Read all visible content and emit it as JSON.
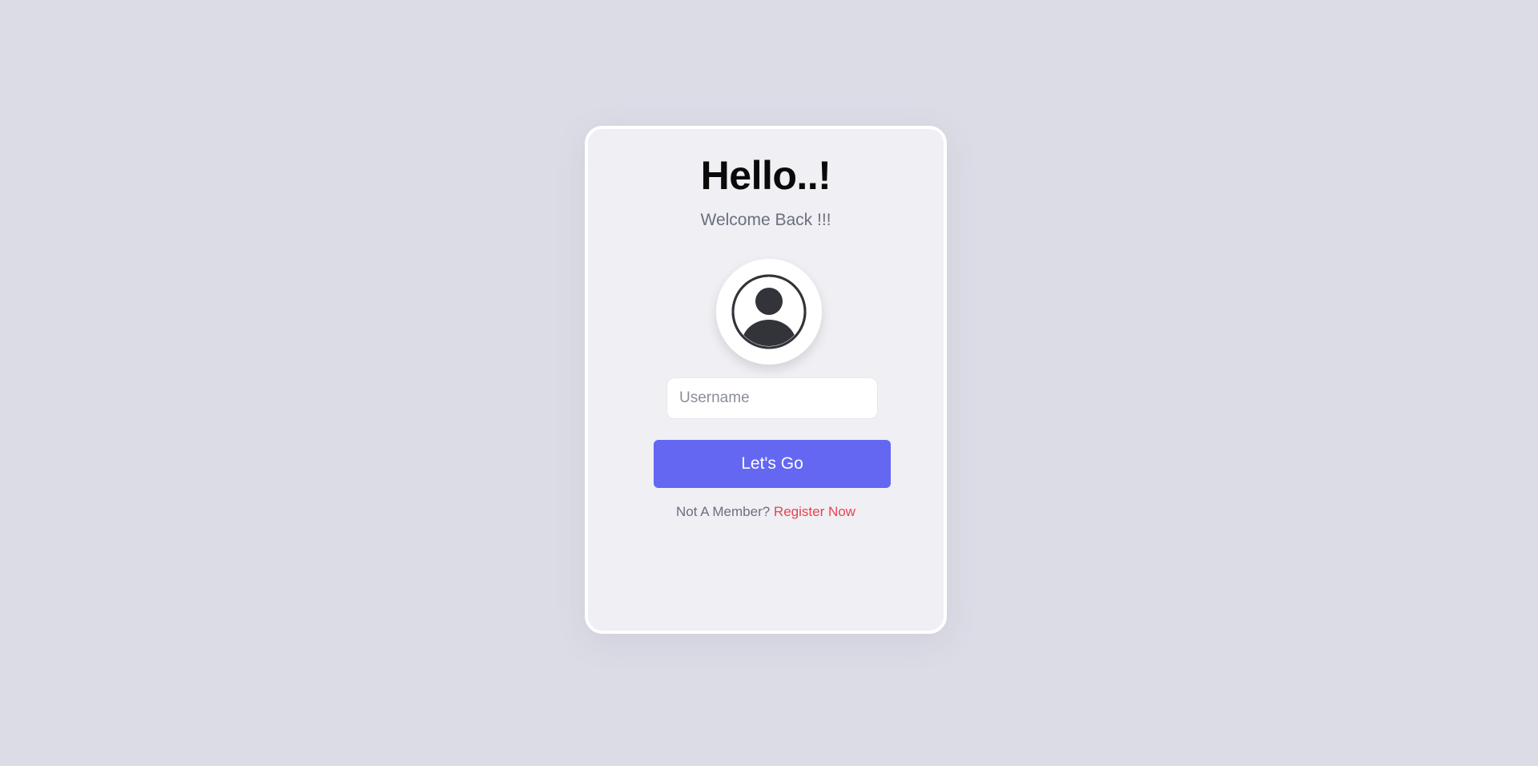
{
  "login": {
    "title": "Hello..!",
    "subtitle": "Welcome Back !!!",
    "avatar_icon": "user-circle-icon",
    "username": {
      "value": "",
      "placeholder": "Username"
    },
    "submit_label": "Let's Go",
    "register_prompt": "Not A Member?",
    "register_link": "Register Now"
  },
  "colors": {
    "background": "#dcdce6",
    "card": "#efeff4",
    "primary_button": "#6467f2",
    "link": "#e8444e",
    "muted_text": "#6b6f7e"
  }
}
